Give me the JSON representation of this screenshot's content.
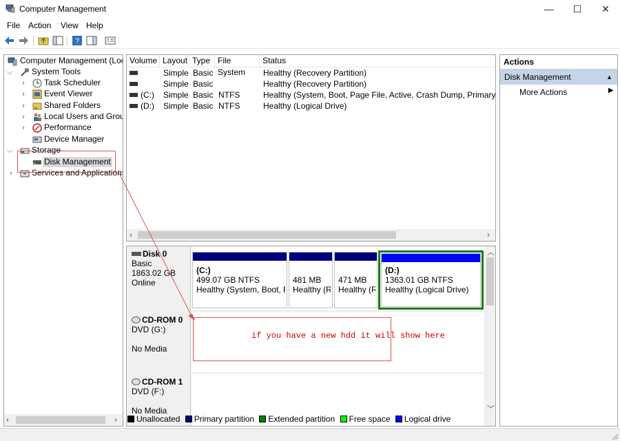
{
  "window": {
    "title": "Computer Management",
    "minimize": "—",
    "maximize": "☐",
    "close": "✕"
  },
  "menu": {
    "file": "File",
    "action": "Action",
    "view": "View",
    "help": "Help"
  },
  "tree": {
    "root": "Computer Management (Local",
    "system_tools": "System Tools",
    "task_scheduler": "Task Scheduler",
    "event_viewer": "Event Viewer",
    "shared_folders": "Shared Folders",
    "local_users": "Local Users and Groups",
    "performance": "Performance",
    "device_manager": "Device Manager",
    "storage": "Storage",
    "disk_management": "Disk Management",
    "services": "Services and Applications"
  },
  "volumes": {
    "headers": [
      "Volume",
      "Layout",
      "Type",
      "File System",
      "Status"
    ],
    "rows": [
      {
        "volume": "",
        "layout": "Simple",
        "type": "Basic",
        "fs": "",
        "status": "Healthy (Recovery Partition)"
      },
      {
        "volume": "",
        "layout": "Simple",
        "type": "Basic",
        "fs": "",
        "status": "Healthy (Recovery Partition)"
      },
      {
        "volume": "(C:)",
        "layout": "Simple",
        "type": "Basic",
        "fs": "NTFS",
        "status": "Healthy (System, Boot, Page File, Active, Crash Dump, Primary Partitio"
      },
      {
        "volume": "(D:)",
        "layout": "Simple",
        "type": "Basic",
        "fs": "NTFS",
        "status": "Healthy (Logical Drive)"
      }
    ]
  },
  "disks": {
    "disk0": {
      "name": "Disk 0",
      "kind": "Basic",
      "size": "1863.02 GB",
      "state": "Online"
    },
    "partitions": [
      {
        "title": "(C:)",
        "size": "499.07 GB NTFS",
        "status": "Healthy (System, Boot, Pa"
      },
      {
        "title": "",
        "size": "481 MB",
        "status": "Healthy (R"
      },
      {
        "title": "",
        "size": "471 MB",
        "status": "Healthy (R"
      },
      {
        "title": "(D:)",
        "size": "1363.01 GB NTFS",
        "status": "Healthy (Logical Drive)"
      }
    ],
    "cdrom0": {
      "name": "CD-ROM 0",
      "drive": "DVD (G:)",
      "media": "No Media"
    },
    "cdrom1": {
      "name": "CD-ROM 1",
      "drive": "DVD (F:)",
      "media": "No Media"
    }
  },
  "legend": {
    "unallocated": "Unallocated",
    "primary": "Primary partition",
    "extended": "Extended partition",
    "free": "Free space",
    "logical": "Logical drive",
    "colors": {
      "unallocated": "#000000",
      "primary": "#00007f",
      "extended": "#008000",
      "free": "#00ff00",
      "logical": "#0000ff"
    }
  },
  "actions": {
    "header": "Actions",
    "section": "Disk Management",
    "more": "More Actions"
  },
  "annotation": {
    "text": "if you have a new hdd it will show here"
  }
}
